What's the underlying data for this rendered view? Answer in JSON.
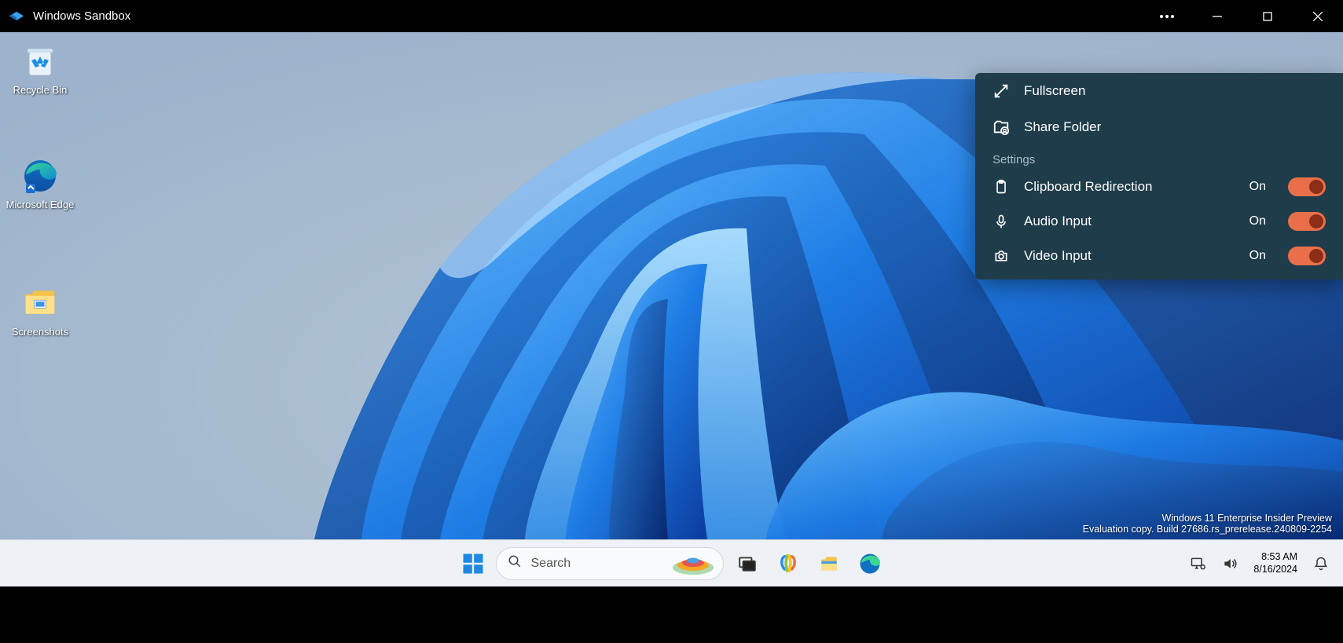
{
  "titlebar": {
    "app_title": "Windows Sandbox"
  },
  "desktop": {
    "icons": [
      {
        "name": "recycle-bin",
        "label": "Recycle Bin"
      },
      {
        "name": "microsoft-edge",
        "label": "Microsoft Edge"
      },
      {
        "name": "screenshots",
        "label": "Screenshots"
      }
    ],
    "watermark": {
      "line1": "Windows 11 Enterprise Insider Preview",
      "line2": "Evaluation copy. Build 27686.rs_prerelease.240809-2254"
    }
  },
  "panel": {
    "actions": [
      {
        "icon": "fullscreen-icon",
        "label": "Fullscreen"
      },
      {
        "icon": "share-folder-icon",
        "label": "Share Folder"
      }
    ],
    "settings_header": "Settings",
    "settings": [
      {
        "icon": "clipboard-icon",
        "label": "Clipboard Redirection",
        "state": "On"
      },
      {
        "icon": "microphone-icon",
        "label": "Audio Input",
        "state": "On"
      },
      {
        "icon": "camera-icon",
        "label": "Video Input",
        "state": "On"
      }
    ]
  },
  "taskbar": {
    "search_placeholder": "Search",
    "clock": {
      "time": "8:53 AM",
      "date": "8/16/2024"
    }
  }
}
